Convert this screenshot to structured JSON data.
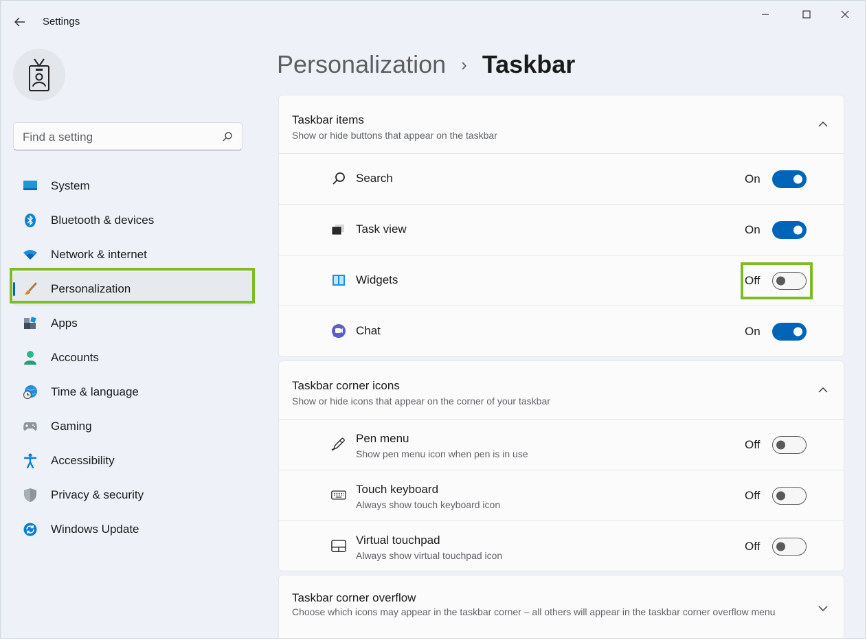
{
  "window": {
    "title": "Settings"
  },
  "user": {
    "avatar_icon": "user-badge-icon"
  },
  "search": {
    "placeholder": "Find a setting"
  },
  "sidebar": {
    "items": [
      {
        "label": "System",
        "icon": "system-icon",
        "active": false
      },
      {
        "label": "Bluetooth & devices",
        "icon": "bluetooth-icon",
        "active": false
      },
      {
        "label": "Network & internet",
        "icon": "wifi-icon",
        "active": false
      },
      {
        "label": "Personalization",
        "icon": "brush-icon",
        "active": true
      },
      {
        "label": "Apps",
        "icon": "apps-icon",
        "active": false
      },
      {
        "label": "Accounts",
        "icon": "accounts-icon",
        "active": false
      },
      {
        "label": "Time & language",
        "icon": "globe-clock-icon",
        "active": false
      },
      {
        "label": "Gaming",
        "icon": "gamepad-icon",
        "active": false
      },
      {
        "label": "Accessibility",
        "icon": "accessibility-icon",
        "active": false
      },
      {
        "label": "Privacy & security",
        "icon": "shield-icon",
        "active": false
      },
      {
        "label": "Windows Update",
        "icon": "update-icon",
        "active": false
      }
    ]
  },
  "breadcrumb": {
    "parent": "Personalization",
    "separator": "›",
    "current": "Taskbar"
  },
  "sections": {
    "taskbar_items": {
      "title": "Taskbar items",
      "subtitle": "Show or hide buttons that appear on the taskbar",
      "rows": [
        {
          "label": "Search",
          "state": "On",
          "on": true,
          "icon": "search-icon"
        },
        {
          "label": "Task view",
          "state": "On",
          "on": true,
          "icon": "task-view-icon"
        },
        {
          "label": "Widgets",
          "state": "Off",
          "on": false,
          "icon": "widgets-icon"
        },
        {
          "label": "Chat",
          "state": "On",
          "on": true,
          "icon": "chat-icon"
        }
      ]
    },
    "corner_icons": {
      "title": "Taskbar corner icons",
      "subtitle": "Show or hide icons that appear on the corner of your taskbar",
      "rows": [
        {
          "label": "Pen menu",
          "sub": "Show pen menu icon when pen is in use",
          "state": "Off",
          "on": false,
          "icon": "pen-icon"
        },
        {
          "label": "Touch keyboard",
          "sub": "Always show touch keyboard icon",
          "state": "Off",
          "on": false,
          "icon": "keyboard-icon"
        },
        {
          "label": "Virtual touchpad",
          "sub": "Always show virtual touchpad icon",
          "state": "Off",
          "on": false,
          "icon": "touchpad-icon"
        }
      ]
    },
    "corner_overflow": {
      "title": "Taskbar corner overflow",
      "subtitle": "Choose which icons may appear in the taskbar corner – all others will appear in the taskbar corner overflow menu"
    }
  },
  "colors": {
    "accent": "#0064b8",
    "highlight": "#7dbb27",
    "background": "#eef2f8"
  }
}
